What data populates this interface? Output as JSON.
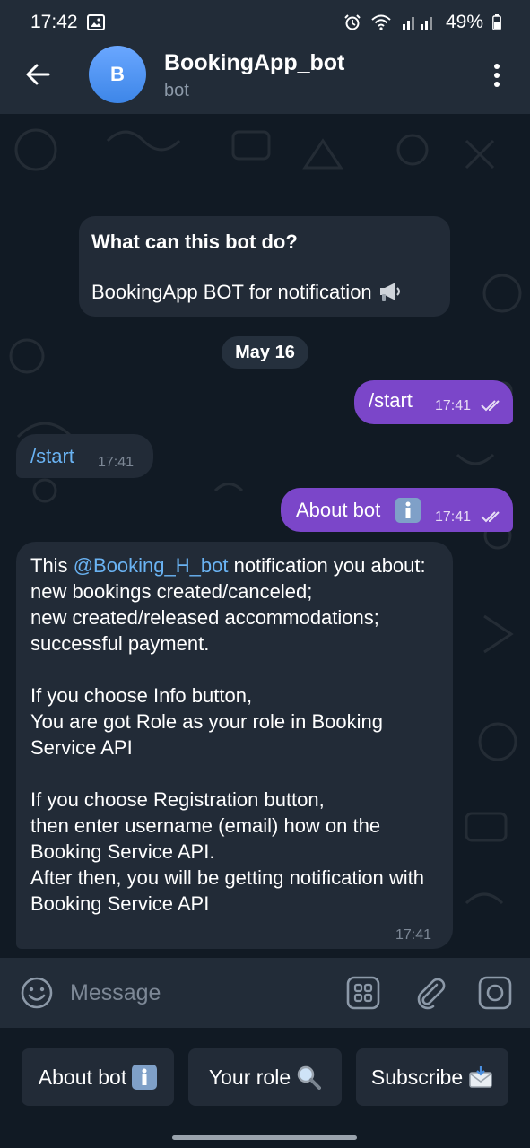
{
  "status_bar": {
    "time": "17:42",
    "battery": "49%"
  },
  "header": {
    "title": "BookingApp_bot",
    "subtitle": "bot",
    "avatar_letter": "B"
  },
  "info_card": {
    "title": "What can this bot do?",
    "body": "BookingApp BOT for notification"
  },
  "date_separator": "May 16",
  "messages": [
    {
      "id": "m1",
      "direction": "out",
      "text": "/start",
      "time": "17:41"
    },
    {
      "id": "m2",
      "direction": "in",
      "text": "/start",
      "time": "17:41"
    },
    {
      "id": "m3",
      "direction": "out",
      "text": "About bot",
      "time": "17:41"
    },
    {
      "id": "m4",
      "direction": "in",
      "time": "17:41",
      "prefix": "This ",
      "mention": "@Booking_H_bot",
      "suffix": " notification you about:",
      "body": "new bookings created/canceled;\nnew created/released accommodations;\nsuccessful payment.\n\nIf you choose Info button,\n You are got Role as your role in Booking Service API\n\nIf you choose Registration button,\n then enter username (email) how on the Booking Service API.\nAfter then, you will be getting notification with Booking Service API"
    }
  ],
  "input": {
    "placeholder": "Message"
  },
  "keyboard_buttons": [
    {
      "label": "About bot",
      "icon": "info-emoji"
    },
    {
      "label": "Your role",
      "icon": "magnifier-emoji"
    },
    {
      "label": "Subscribe",
      "icon": "envelope-emoji"
    }
  ],
  "colors": {
    "outgoing_bubble": "#7b46c9",
    "incoming_bubble": "#222b37",
    "header": "#222c38",
    "mention": "#6ab3f3"
  }
}
